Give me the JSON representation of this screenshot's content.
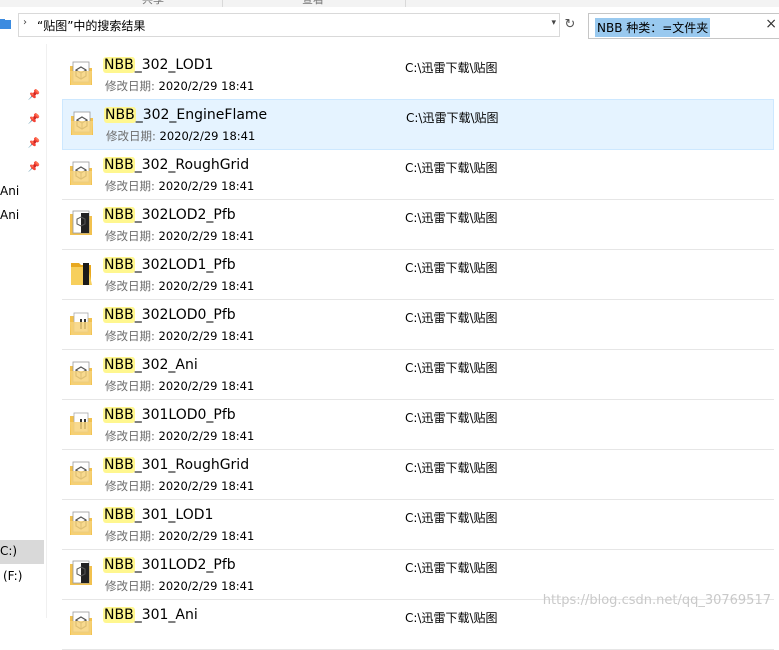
{
  "ribbon": {
    "tab_fragments": [
      "共享",
      "查看"
    ]
  },
  "address_bar": {
    "path_text": "“贴图”中的搜索结果",
    "search_value": "NBB 种类：=文件夹"
  },
  "nav_pane": {
    "fragments": [
      "Ani",
      "Ani",
      "C:)",
      "(F:)"
    ]
  },
  "results": [
    {
      "highlight": "NBB",
      "suffix": "_302_LOD1",
      "date_label": "修改日期:",
      "date": "2020/2/29 18:41",
      "path": "C:\\迅雷下载\\贴图",
      "icon": "folder-3d-icon"
    },
    {
      "highlight": "NBB",
      "suffix": "_302_EngineFlame",
      "date_label": "修改日期:",
      "date": "2020/2/29 18:41",
      "path": "C:\\迅雷下载\\贴图",
      "icon": "folder-3d-icon"
    },
    {
      "highlight": "NBB",
      "suffix": "_302_RoughGrid",
      "date_label": "修改日期:",
      "date": "2020/2/29 18:41",
      "path": "C:\\迅雷下载\\贴图",
      "icon": "folder-3d-icon"
    },
    {
      "highlight": "NBB",
      "suffix": "_302LOD2_Pfb",
      "date_label": "修改日期:",
      "date": "2020/2/29 18:41",
      "path": "C:\\迅雷下载\\贴图",
      "icon": "folder-dark-icon"
    },
    {
      "highlight": "NBB",
      "suffix": "_302LOD1_Pfb",
      "date_label": "修改日期:",
      "date": "2020/2/29 18:41",
      "path": "C:\\迅雷下载\\贴图",
      "icon": "folder-open-icon"
    },
    {
      "highlight": "NBB",
      "suffix": "_302LOD0_Pfb",
      "date_label": "修改日期:",
      "date": "2020/2/29 18:41",
      "path": "C:\\迅雷下载\\贴图",
      "icon": "folder-files-icon"
    },
    {
      "highlight": "NBB",
      "suffix": "_302_Ani",
      "date_label": "修改日期:",
      "date": "2020/2/29 18:41",
      "path": "C:\\迅雷下载\\贴图",
      "icon": "folder-3d-icon"
    },
    {
      "highlight": "NBB",
      "suffix": "_301LOD0_Pfb",
      "date_label": "修改日期:",
      "date": "2020/2/29 18:41",
      "path": "C:\\迅雷下载\\贴图",
      "icon": "folder-files-icon"
    },
    {
      "highlight": "NBB",
      "suffix": "_301_RoughGrid",
      "date_label": "修改日期:",
      "date": "2020/2/29 18:41",
      "path": "C:\\迅雷下载\\贴图",
      "icon": "folder-3d-icon"
    },
    {
      "highlight": "NBB",
      "suffix": "_301_LOD1",
      "date_label": "修改日期:",
      "date": "2020/2/29 18:41",
      "path": "C:\\迅雷下载\\贴图",
      "icon": "folder-3d-icon"
    },
    {
      "highlight": "NBB",
      "suffix": "_301LOD2_Pfb",
      "date_label": "修改日期:",
      "date": "2020/2/29 18:41",
      "path": "C:\\迅雷下载\\贴图",
      "icon": "folder-dark-icon"
    },
    {
      "highlight": "NBB",
      "suffix": "_301_Ani",
      "date_label": "",
      "date": "",
      "path": "C:\\迅雷下载\\贴图",
      "icon": "folder-3d-icon"
    }
  ],
  "watermark": "https://blog.csdn.net/qq_30769517",
  "colors": {
    "selected_row": "#e5f3ff",
    "highlight": "#fff78f",
    "search_selection": "#99c9ef"
  }
}
